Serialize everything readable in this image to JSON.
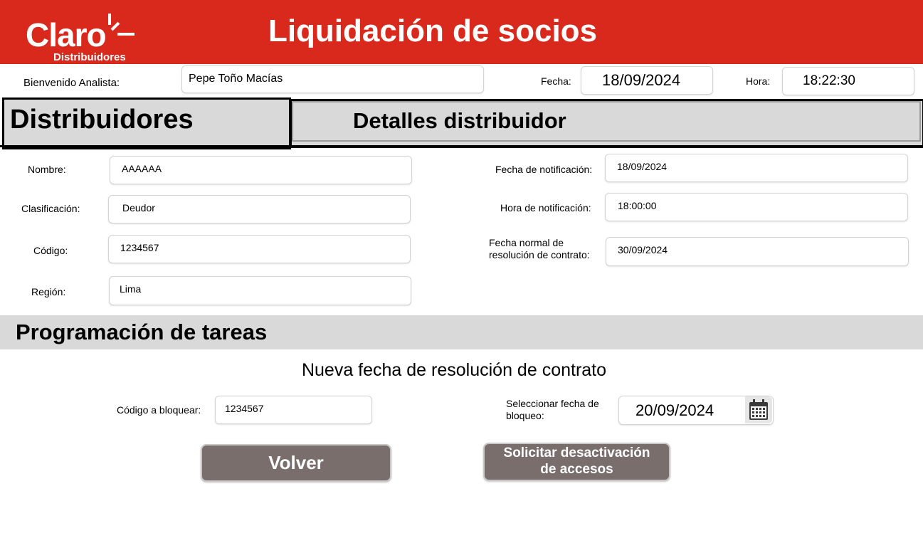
{
  "header": {
    "logo_text": "Claro",
    "logo_sub": "Distribuidores",
    "title": "Liquidación de socios",
    "color": "#d9291c"
  },
  "user_bar": {
    "welcome_label": "Bienvenido Analista:",
    "analyst_name": "Pepe Toño Macías",
    "date_label": "Fecha:",
    "date_value": "18/09/2024",
    "time_label": "Hora:",
    "time_value": "18:22:30"
  },
  "sections": {
    "left_title": "Distribuidores",
    "right_title": "Detalles distribuidor"
  },
  "distributor": {
    "name_label": "Nombre:",
    "name_value": "AAAAAA",
    "class_label": "Clasificación:",
    "class_value": "Deudor",
    "code_label": "Código:",
    "code_value": "1234567",
    "region_label": "Región:",
    "region_value": "Lima",
    "notif_date_label": "Fecha de notificación:",
    "notif_date_value": "18/09/2024",
    "notif_time_label": "Hora de notificación:",
    "notif_time_value": "18:00:00",
    "normal_date_label_1": "Fecha normal de",
    "normal_date_label_2": "resolución de contrato:",
    "normal_date_value": "30/09/2024"
  },
  "tasks": {
    "title": "Programación de tareas",
    "subtitle": "Nueva fecha de resolución de contrato",
    "block_code_label": "Código a bloquear:",
    "block_code_value": "1234567",
    "block_date_label_1": "Seleccionar fecha de",
    "block_date_label_2": "bloqueo:",
    "block_date_value": "20/09/2024",
    "calendar_icon": "calendar-icon"
  },
  "buttons": {
    "back": "Volver",
    "request_1": "Solicitar desactivación",
    "request_2": "de accesos",
    "color": "#7a6e6d"
  }
}
